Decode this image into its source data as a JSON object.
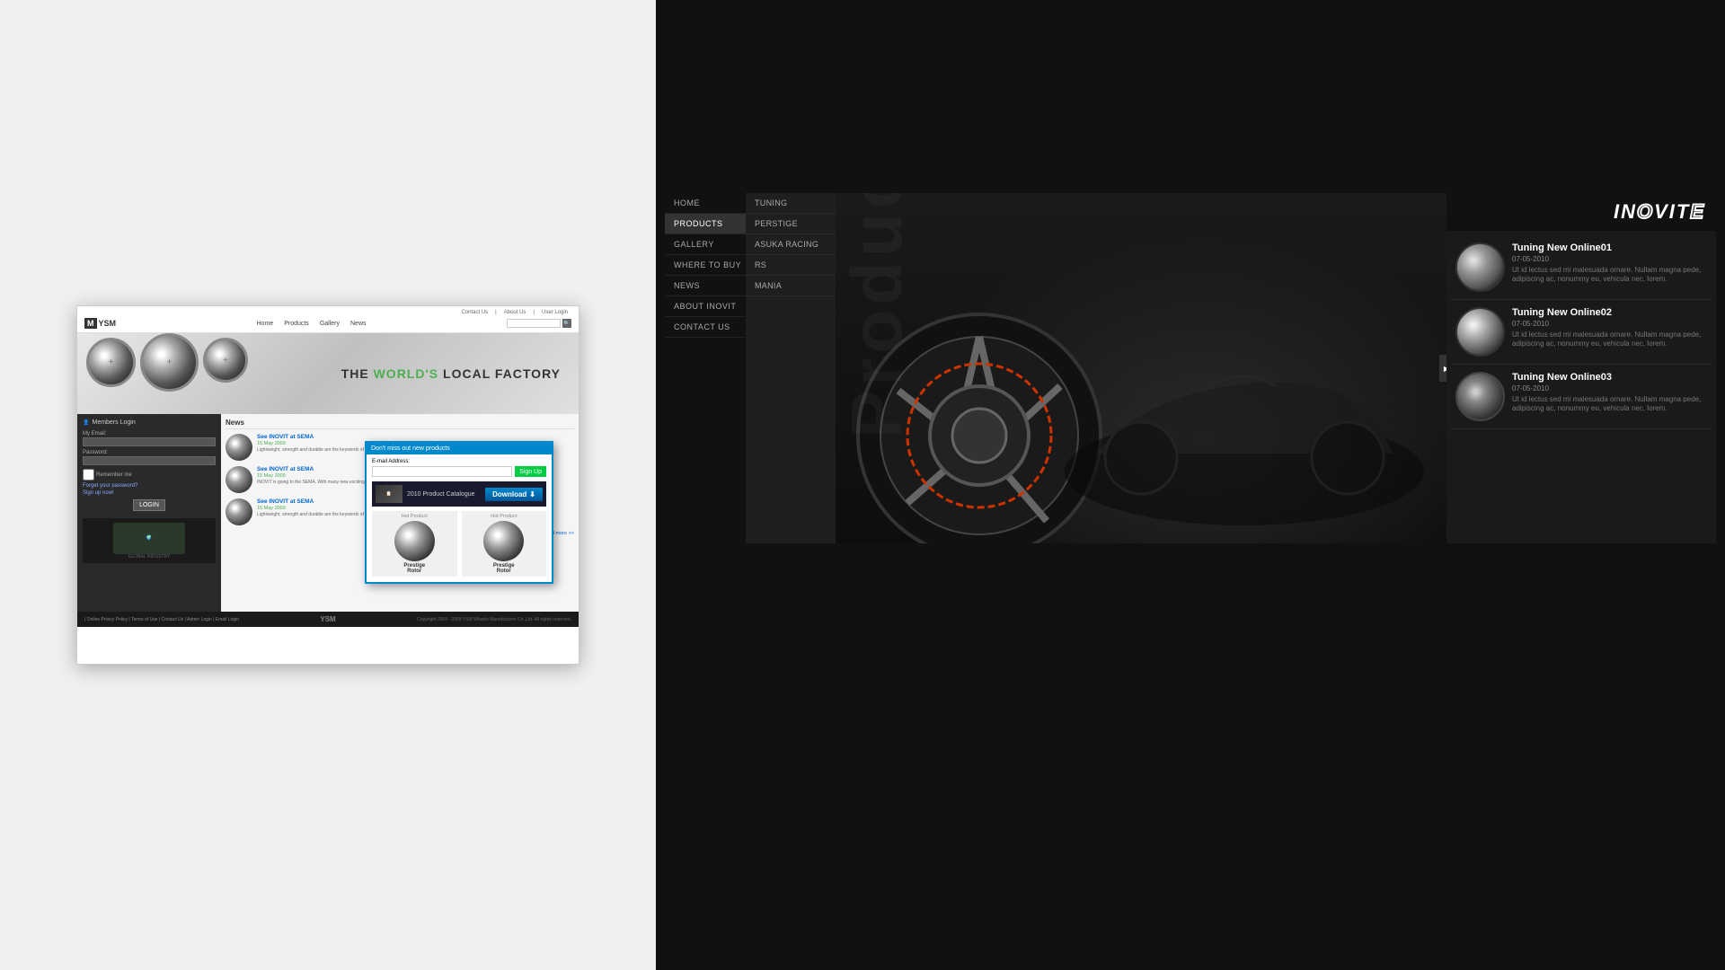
{
  "left": {
    "ysm": {
      "logo": "YSM",
      "logo_m": "M",
      "nav": {
        "items": [
          "Home",
          "Products",
          "Gallery",
          "News"
        ]
      },
      "topbar": {
        "links": [
          "Contact Us",
          "|",
          "About Us",
          "|",
          "User Login"
        ]
      },
      "hero": {
        "title_plain": "THE",
        "title_highlight": "WORLD'S",
        "title_rest": "LOCAL FACTORY"
      },
      "login": {
        "title": "Members Login",
        "email_label": "My Email:",
        "password_label": "Password:",
        "remember": "Remember me",
        "forgot": "Forget your password?",
        "signup": "Sign up now!",
        "btn": "LOGIN",
        "global": "GLOBAL INDUSTRY"
      },
      "news_section": {
        "title": "News",
        "items": [
          {
            "headline": "See INOVIT at SEMA",
            "date": "15 May 2009",
            "desc": "Lightweight, strength and durable are the keywords of all Asuka Racing designs"
          },
          {
            "headline": "See INOVIT at SEMA",
            "date": "15 May 2009",
            "desc": "INOVIT is going to the SEMA. With many new exciting products exclusively prepared for the show. As this will be the first..."
          },
          {
            "headline": "See INOVIT at SEMA",
            "date": "15 May 2009",
            "desc": "Lightweight, strength and durable are the keywords of all Asuka Racing designs"
          }
        ],
        "read_more": "read more >>"
      },
      "popup": {
        "header": "Don't miss out new products",
        "email_label": "E-mail Address:",
        "signup_btn": "Sign Up",
        "download_title": "2010 Product Catalogue",
        "download_btn": "Download",
        "hot_label1": "Hot Product",
        "hot_label2": "Hot Product",
        "product1_name": "Prestige",
        "product1_sub": "Rotor",
        "product2_name": "Prestige",
        "product2_sub": "Rotor"
      },
      "footer": {
        "links": "| Online Privicy Policy | Terms of Use | Contact Us | Admin Login | Email Login",
        "copyright": "Copyright 2004 - 2009 YSM Wheels Manufacturer Co.,Ltd. All rights reserved."
      }
    }
  },
  "right": {
    "inovit": {
      "logo": "INOVIT",
      "nav": {
        "items": [
          {
            "label": "HOME",
            "active": false
          },
          {
            "label": "PRODUCTS",
            "active": true
          },
          {
            "label": "GALLERY",
            "active": false
          },
          {
            "label": "WHERE TO BUY",
            "active": false
          },
          {
            "label": "NEWS",
            "active": false
          },
          {
            "label": "ABOUT INOVIT",
            "active": false
          },
          {
            "label": "CONTACT US",
            "active": false
          }
        ]
      },
      "submenu": {
        "items": [
          "TUNING",
          "PERSTIGE",
          "ASUKA RACING",
          "RS",
          "MANIA"
        ]
      },
      "news": {
        "items": [
          {
            "title": "Tuning New Online01",
            "date": "07-05-2010",
            "desc": "Ut id lectus sed mi malesuada ornare. Nullam magna pede, adipiscing ac, nonummy eu, vehicula nec, lorem."
          },
          {
            "title": "Tuning New Online02",
            "date": "07-05-2010",
            "desc": "Ut id lectus sed mi malesuada ornare. Nullam magna pede, adipiscing ac, nonummy eu, vehicula nec, lorem."
          },
          {
            "title": "Tuning New Online03",
            "date": "07-05-2010",
            "desc": "Ut id lectus sed mi malesuada ornare. Nullam magna pede, adipiscing ac, nonummy eu, vehicula nec, lorem."
          }
        ]
      },
      "product_bg_text": "Product"
    }
  }
}
